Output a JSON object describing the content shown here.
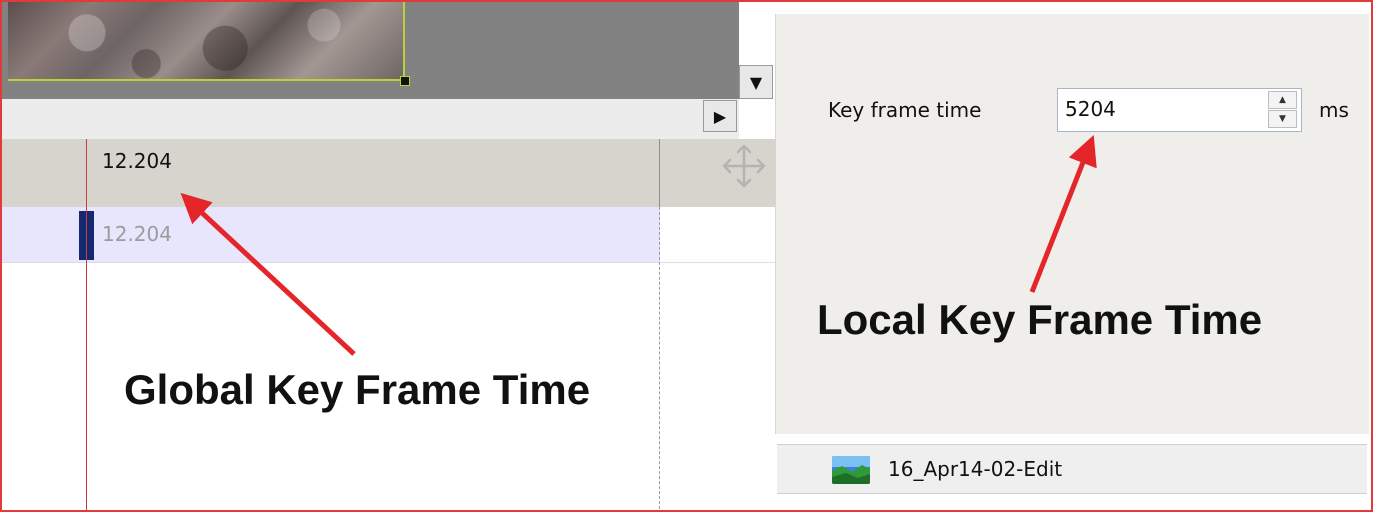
{
  "timeline": {
    "ruler_time": "12.204",
    "track_time": "12.204"
  },
  "properties": {
    "key_frame_label": "Key frame time",
    "key_frame_value": "5204",
    "key_frame_unit": "ms"
  },
  "media_item": {
    "name": "16_Apr14-02-Edit"
  },
  "annotations": {
    "global_label": "Global Key Frame Time",
    "local_label": "Local Key Frame Time"
  },
  "colors": {
    "annotation_arrow": "#e4262a",
    "frame_border": "#e03a3a",
    "track_marker": "#16286e"
  },
  "icons": {
    "move": "move-icon",
    "scroll_down": "triangle-down-icon",
    "scroll_right": "triangle-right-icon",
    "image": "image-thumbnail-icon"
  }
}
